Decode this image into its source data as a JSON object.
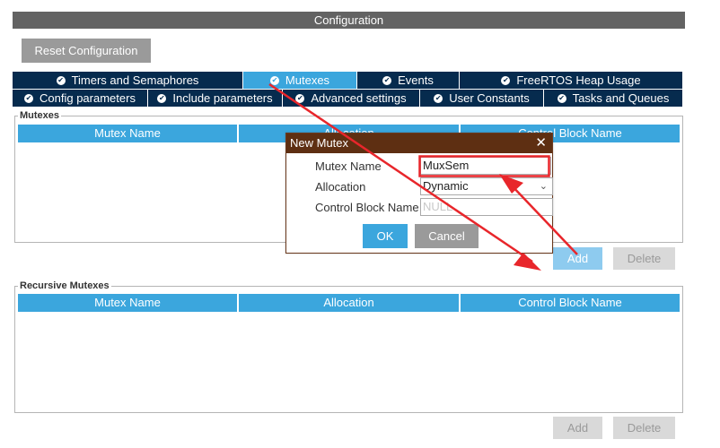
{
  "window": {
    "title": "Configuration"
  },
  "toolbar": {
    "reset_label": "Reset Configuration"
  },
  "tabs_row1": [
    {
      "label": "Timers and Semaphores",
      "icon": "check-circle-icon"
    },
    {
      "label": "Mutexes",
      "icon": "check-circle-icon",
      "active": true
    },
    {
      "label": "Events",
      "icon": "check-circle-icon"
    },
    {
      "label": "FreeRTOS Heap Usage",
      "icon": "check-circle-icon"
    }
  ],
  "tabs_row2": [
    {
      "label": "Config parameters",
      "icon": "check-circle-icon"
    },
    {
      "label": "Include parameters",
      "icon": "check-circle-icon"
    },
    {
      "label": "Advanced settings",
      "icon": "check-circle-icon"
    },
    {
      "label": "User Constants",
      "icon": "check-circle-icon"
    },
    {
      "label": "Tasks and Queues",
      "icon": "check-circle-icon"
    }
  ],
  "mutexes": {
    "legend": "Mutexes",
    "columns": [
      "Mutex Name",
      "Allocation",
      "Control Block Name"
    ],
    "add_label": "Add",
    "delete_label": "Delete"
  },
  "recursive_mutexes": {
    "legend": "Recursive Mutexes",
    "columns": [
      "Mutex Name",
      "Allocation",
      "Control Block Name"
    ],
    "add_label": "Add",
    "delete_label": "Delete"
  },
  "dialog": {
    "title": "New Mutex",
    "close_glyph": "✕",
    "name_label": "Mutex Name",
    "name_value": "MuxSem",
    "allocation_label": "Allocation",
    "allocation_value": "Dynamic",
    "cb_label": "Control Block Name",
    "cb_placeholder": "NULL",
    "ok_label": "OK",
    "cancel_label": "Cancel"
  },
  "colors": {
    "tab_bg": "#062b4e",
    "tab_active": "#3ba6dd",
    "header_blue": "#3ba6dd",
    "dialog_title": "#5e2f12",
    "annotation_red": "#e8262b"
  }
}
